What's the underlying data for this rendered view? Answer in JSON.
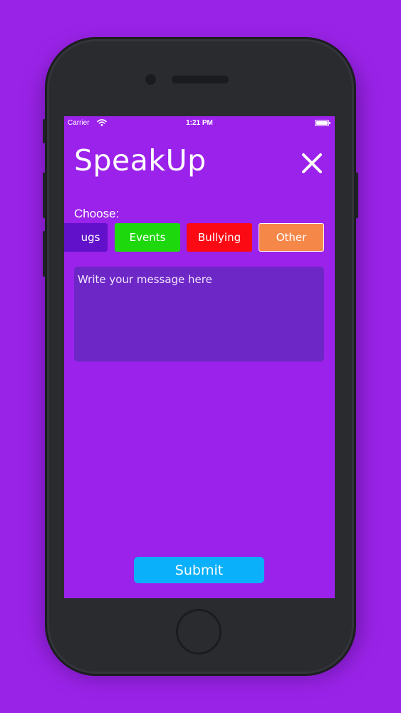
{
  "colors": {
    "background": "#9a23e8",
    "screen": "#9b22ea",
    "phone_body": "#2a2b2f",
    "message_box": "#6d27c6",
    "submit": "#0ab0f9",
    "drugs": "#6011c9",
    "events": "#1ed80e",
    "bullying": "#fb0a14",
    "other": "#f58849"
  },
  "status_bar": {
    "carrier": "Carrier",
    "time": "1:21 PM",
    "icons": [
      "wifi-icon",
      "battery-icon"
    ]
  },
  "header": {
    "title": "SpeakUp",
    "close_icon": "close-icon"
  },
  "category_section": {
    "label": "Choose:",
    "options": [
      {
        "label": "Drugs",
        "visible_text": "ugs"
      },
      {
        "label": "Events"
      },
      {
        "label": "Bullying"
      },
      {
        "label": "Other"
      }
    ]
  },
  "message": {
    "placeholder": "Write your message here",
    "value": ""
  },
  "submit": {
    "label": "Submit"
  }
}
